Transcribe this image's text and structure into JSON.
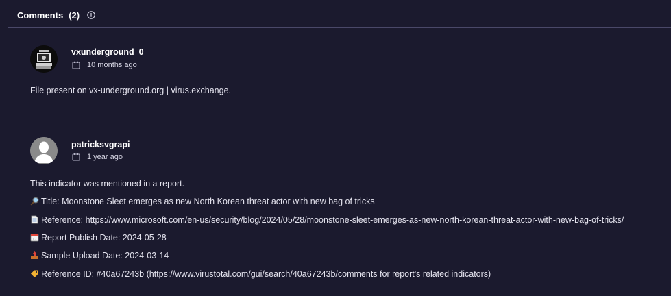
{
  "header": {
    "title": "Comments",
    "count": "(2)",
    "icon": "info-icon"
  },
  "comments": [
    {
      "username": "vxunderground_0",
      "time": "10 months ago",
      "avatar": "vxunderground-logo",
      "lines": [
        "File present on vx-underground.org | virus.exchange."
      ]
    },
    {
      "username": "patricksvgrapi",
      "time": "1 year ago",
      "avatar": "default-user-silhouette",
      "lines": [
        {
          "icon": "",
          "text": "This indicator was mentioned in a report."
        },
        {
          "icon": "magnifier-emoji",
          "text": "Title: Moonstone Sleet emerges as new North Korean threat actor with new bag of tricks"
        },
        {
          "icon": "page-emoji",
          "text": "Reference: https://www.microsoft.com/en-us/security/blog/2024/05/28/moonstone-sleet-emerges-as-new-north-korean-threat-actor-with-new-bag-of-tricks/"
        },
        {
          "icon": "calendar-emoji",
          "text": "Report Publish Date: 2024-05-28"
        },
        {
          "icon": "outbox-emoji",
          "text": "Sample Upload Date: 2024-03-14"
        },
        {
          "icon": "label-emoji",
          "text": "Reference ID: #40a67243b (https://www.virustotal.com/gui/search/40a67243b/comments for report's related indicators)"
        }
      ]
    }
  ],
  "colors": {
    "background": "#1b1a2e",
    "divider": "#3f3d58",
    "text": "#e4e3ee"
  }
}
